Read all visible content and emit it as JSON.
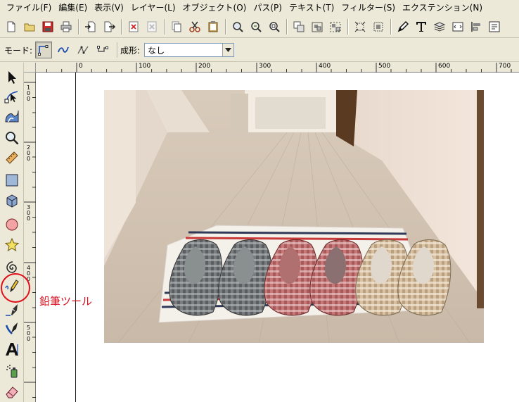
{
  "menu": [
    {
      "label": "ファイル(F)",
      "name": "menu-file"
    },
    {
      "label": "編集(E)",
      "name": "menu-edit"
    },
    {
      "label": "表示(V)",
      "name": "menu-view"
    },
    {
      "label": "レイヤー(L)",
      "name": "menu-layer"
    },
    {
      "label": "オブジェクト(O)",
      "name": "menu-object"
    },
    {
      "label": "パス(P)",
      "name": "menu-path"
    },
    {
      "label": "テキスト(T)",
      "name": "menu-text"
    },
    {
      "label": "フィルター(S)",
      "name": "menu-filters"
    },
    {
      "label": "エクステンション(N)",
      "name": "menu-extensions"
    }
  ],
  "controls": {
    "mode_label": "モード:",
    "shape_label": "成形:",
    "shape_value": "なし"
  },
  "ruler_ticks": [
    "0",
    "100",
    "200",
    "300",
    "400",
    "500",
    "600",
    "700"
  ],
  "vruler_ticks": [
    "1",
    "0",
    "0",
    "2",
    "0",
    "0",
    "3",
    "0",
    "0",
    "4",
    "0",
    "0",
    "5",
    "0",
    "0"
  ],
  "annotation": {
    "label": "鉛筆ツール",
    "color": "#d81020"
  },
  "colors": {
    "chrome": "#ece9d8",
    "canvas": "#ffffff",
    "annotation": "#e0101a"
  }
}
